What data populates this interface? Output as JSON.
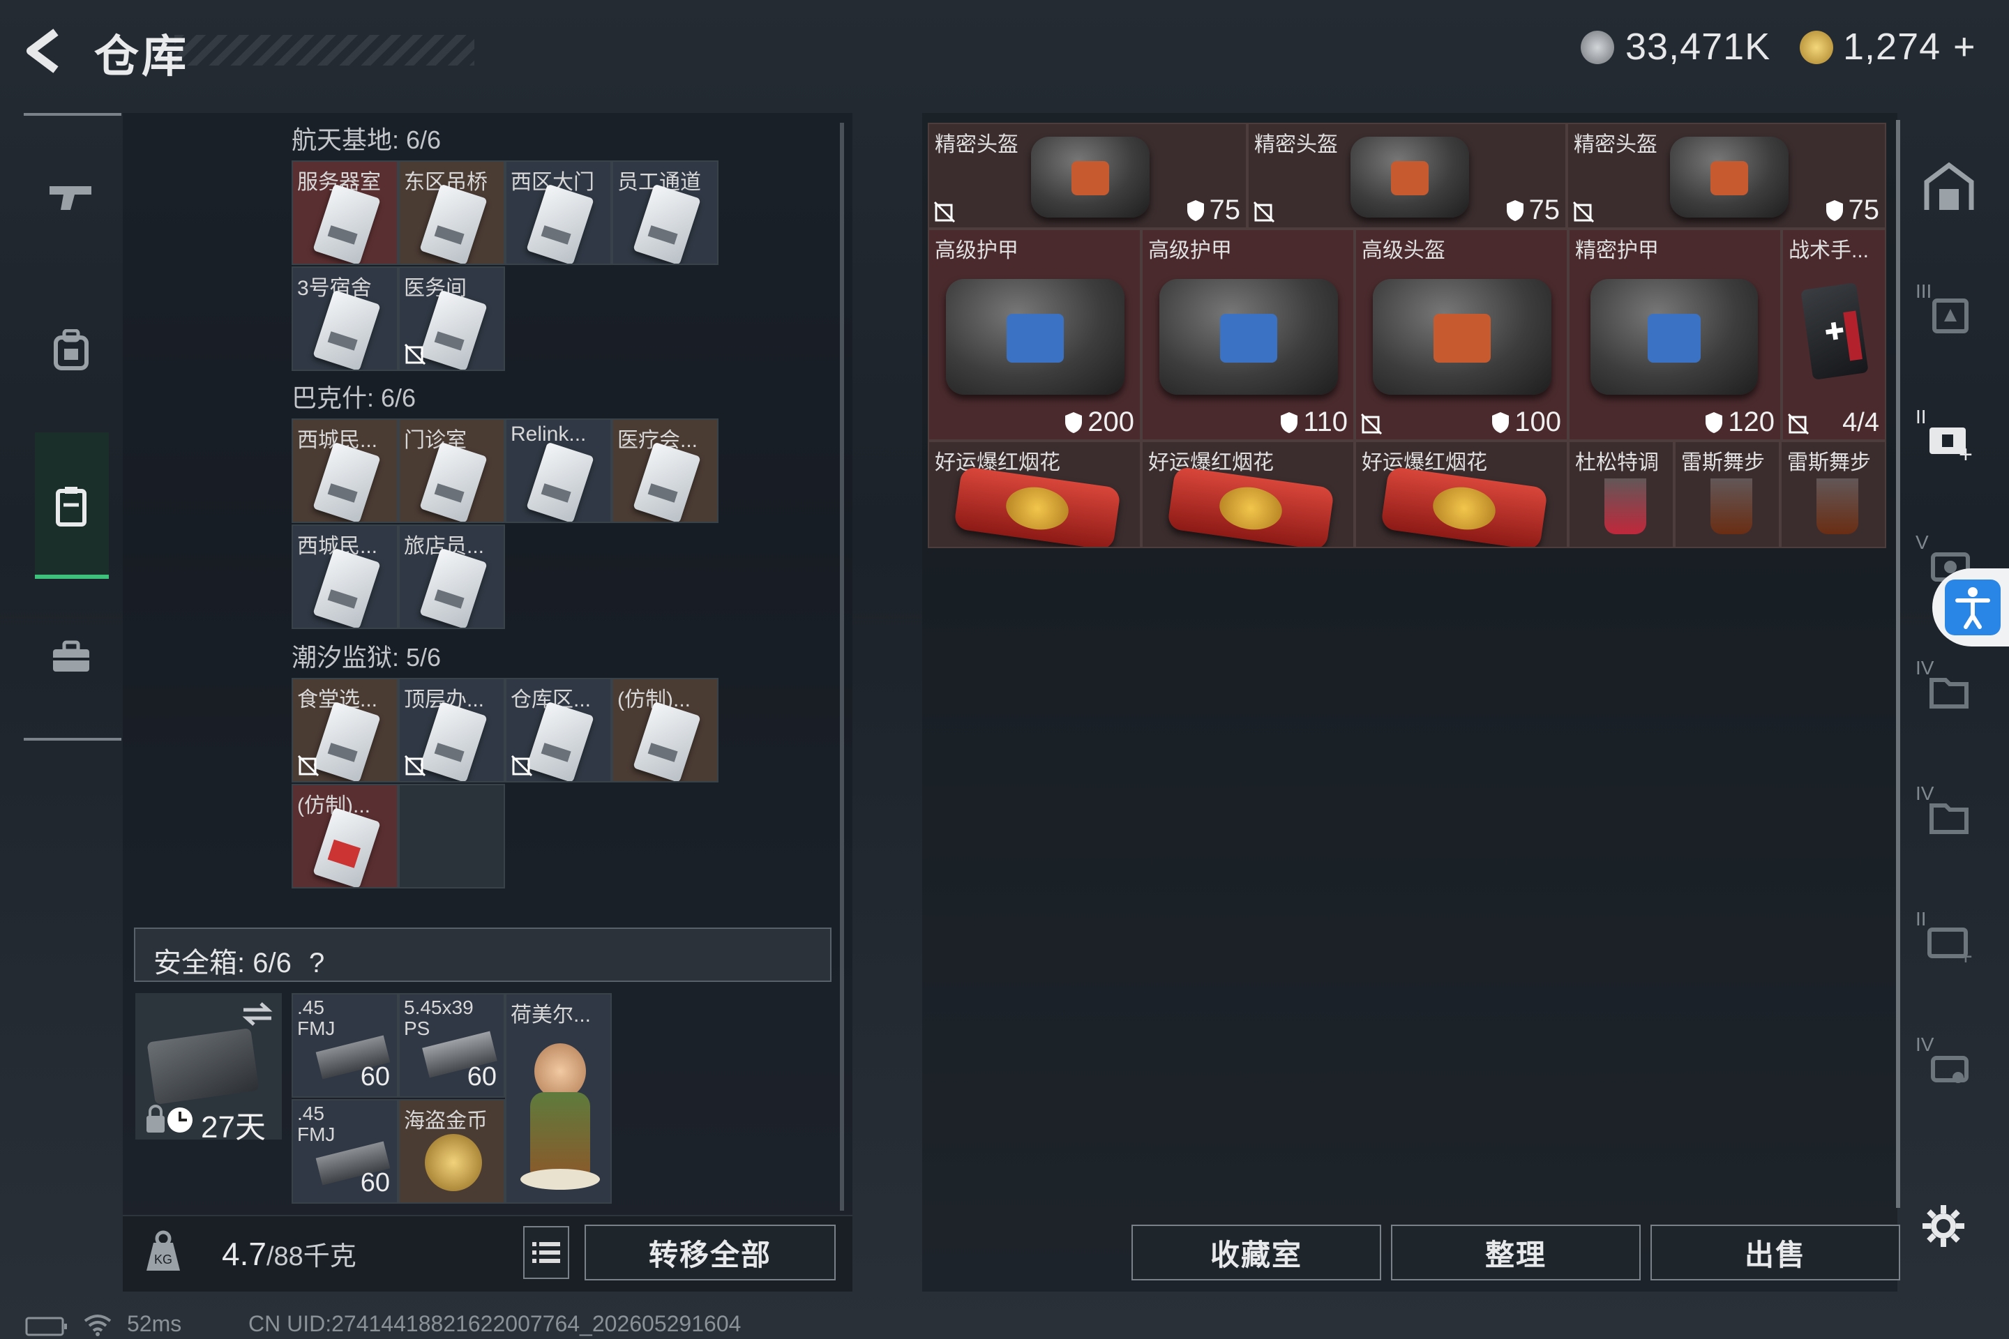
{
  "header": {
    "title": "仓库",
    "currency1": "33,471K",
    "currency2": "1,274",
    "plus": "+"
  },
  "nav": {
    "icons": [
      "gun-icon",
      "backpack-icon",
      "storage-icon",
      "toolbox-icon"
    ]
  },
  "stash": {
    "sections": [
      {
        "title": "航天基地: 6/6",
        "items": [
          "服务器室",
          "东区吊桥",
          "西区大门",
          "员工通道",
          "3号宿舍",
          "医务间"
        ]
      },
      {
        "title": "巴克什: 6/6",
        "items": [
          "西城民...",
          "门诊室",
          "Relink...",
          "医疗会...",
          "西城民...",
          "旅店员..."
        ]
      },
      {
        "title": "潮汐监狱: 5/6",
        "items": [
          "食堂选...",
          "顶层办...",
          "仓库区...",
          "(仿制)...",
          "(仿制)..."
        ]
      }
    ],
    "safe_box": {
      "title": "安全箱:",
      "count": "6/6",
      "help": "?",
      "timer": "27天",
      "items": [
        {
          "label": ".45 FMJ",
          "count": "60"
        },
        {
          "label": "5.45x39 PS",
          "count": "60"
        },
        {
          "label": "荷美尔...",
          "count": ""
        },
        {
          "label": ".45 FMJ",
          "count": "60"
        },
        {
          "label": "海盗金币",
          "count": ""
        }
      ]
    },
    "weight": "4.7",
    "weight_max": "/88千克",
    "transfer_all": "转移全部"
  },
  "inventory": {
    "row1": [
      {
        "label": "精密头盔",
        "armor": "75"
      },
      {
        "label": "精密头盔",
        "armor": "75"
      },
      {
        "label": "精密头盔",
        "armor": "75"
      }
    ],
    "row2": [
      {
        "label": "高级护甲",
        "armor": "200"
      },
      {
        "label": "高级护甲",
        "armor": "110"
      },
      {
        "label": "高级头盔",
        "armor": "100"
      },
      {
        "label": "精密护甲",
        "armor": "120"
      },
      {
        "label": "战术手...",
        "count": "4/4"
      }
    ],
    "row3": [
      {
        "label": "好运爆红烟花"
      },
      {
        "label": "好运爆红烟花"
      },
      {
        "label": "好运爆红烟花"
      },
      {
        "label": "杜松特调"
      },
      {
        "label": "雷斯舞步"
      },
      {
        "label": "雷斯舞步"
      }
    ]
  },
  "buttons": {
    "collection": "收藏室",
    "organize": "整理",
    "sell": "出售"
  },
  "status": {
    "ping": "52ms",
    "uid": "CN UID:27414418821622007764_202605291604"
  },
  "side_tiers": [
    "III",
    "II",
    "V",
    "IV",
    "IV",
    "II",
    "IV"
  ]
}
